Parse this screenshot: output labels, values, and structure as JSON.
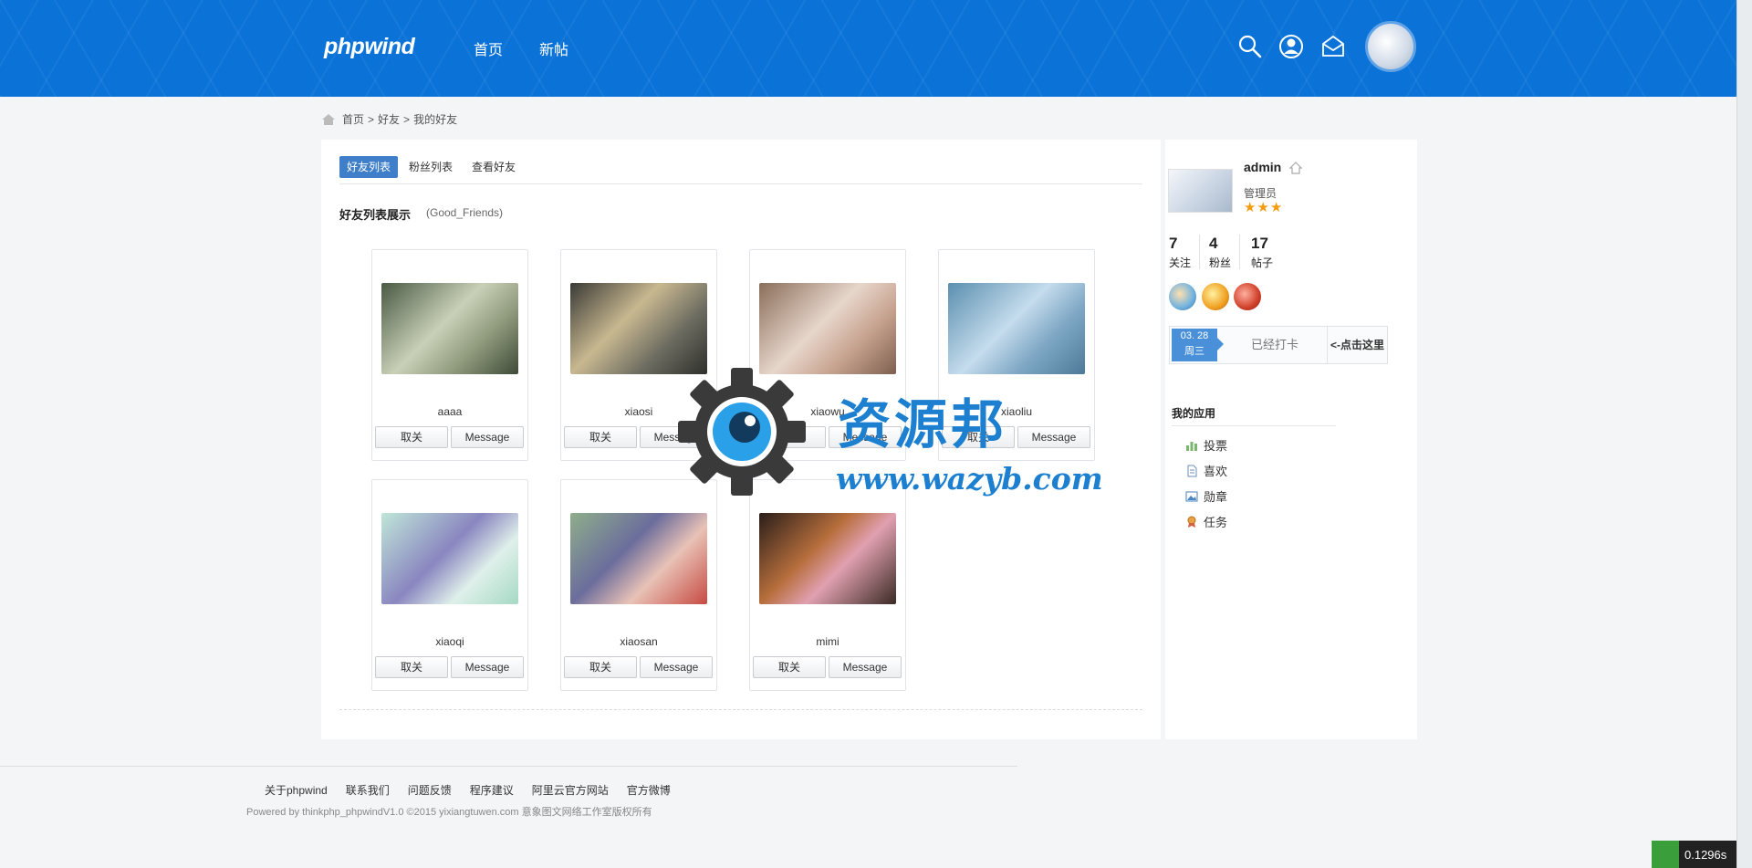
{
  "header": {
    "logo": "phpwind",
    "nav": [
      "首页",
      "新帖"
    ],
    "icons": [
      "search-icon",
      "user-icon",
      "mail-icon"
    ]
  },
  "breadcrumb": [
    "首页",
    ">",
    "好友",
    ">",
    "我的好友"
  ],
  "tabs": [
    "好友列表",
    "粉丝列表",
    "查看好友"
  ],
  "section": {
    "title": "好友列表展示",
    "subtitle": "(Good_Friends)"
  },
  "friends": [
    {
      "name": "aaaa",
      "unfollow": "取关",
      "message": "Message"
    },
    {
      "name": "xiaosi",
      "unfollow": "取关",
      "message": "Message"
    },
    {
      "name": "xiaowu",
      "unfollow": "取关",
      "message": "Message"
    },
    {
      "name": "xiaoliu",
      "unfollow": "取关",
      "message": "Message"
    },
    {
      "name": "xiaoqi",
      "unfollow": "取关",
      "message": "Message"
    },
    {
      "name": "xiaosan",
      "unfollow": "取关",
      "message": "Message"
    },
    {
      "name": "mimi",
      "unfollow": "取关",
      "message": "Message"
    }
  ],
  "profile": {
    "name": "admin",
    "role": "管理员",
    "stars": "★★★",
    "stats": [
      {
        "num": "7",
        "label": "关注"
      },
      {
        "num": "4",
        "label": "粉丝"
      },
      {
        "num": "17",
        "label": "帖子"
      }
    ],
    "checkin": {
      "date": "03. 28",
      "weekday": "周三",
      "status": "已经打卡",
      "hint": "<-点击这里"
    }
  },
  "apps": {
    "title": "我的应用",
    "items": [
      "投票",
      "喜欢",
      "勋章",
      "任务"
    ]
  },
  "footer": {
    "links": [
      "关于phpwind",
      "联系我们",
      "问题反馈",
      "程序建议",
      "阿里云官方网站",
      "官方微博"
    ],
    "copyright": "Powered by thinkphp_phpwindV1.0 ©2015 yixiangtuwen.com 意象图文网络工作室版权所有"
  },
  "watermark": {
    "title": "资源邦",
    "url": "www.wazyb.com"
  },
  "timer": "0.1296s",
  "colors": {
    "header": "#0b73d8",
    "accent": "#3f7fc9",
    "stars": "#f29b0c"
  }
}
